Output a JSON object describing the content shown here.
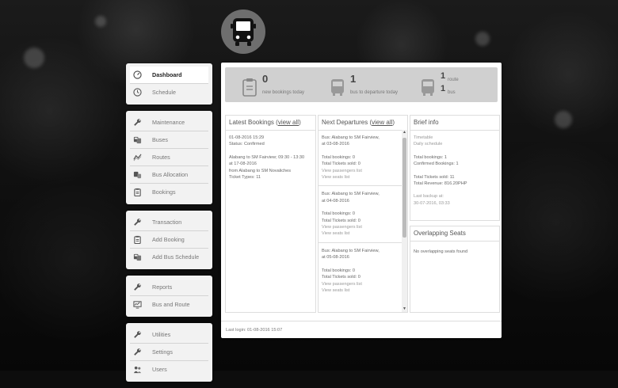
{
  "sidebar": {
    "groups": [
      {
        "items": [
          {
            "label": "Dashboard",
            "icon": "dashboard-icon",
            "active": true
          },
          {
            "label": "Schedule",
            "icon": "clock-icon"
          }
        ]
      },
      {
        "items": [
          {
            "label": "Maintenance",
            "icon": "wrench-icon"
          },
          {
            "label": "Buses",
            "icon": "buses-icon"
          },
          {
            "label": "Routes",
            "icon": "route-icon"
          },
          {
            "label": "Bus Allocation",
            "icon": "bus-allocation-icon"
          },
          {
            "label": "Bookings",
            "icon": "clipboard-icon"
          }
        ]
      },
      {
        "items": [
          {
            "label": "Transaction",
            "icon": "wrench-icon"
          },
          {
            "label": "Add Booking",
            "icon": "clipboard-icon"
          },
          {
            "label": "Add Bus Schedule",
            "icon": "buses-icon"
          }
        ]
      },
      {
        "items": [
          {
            "label": "Reports",
            "icon": "wrench-icon"
          },
          {
            "label": "Bus and Route",
            "icon": "chart-icon"
          }
        ]
      },
      {
        "items": [
          {
            "label": "Utilities",
            "icon": "wrench-icon"
          },
          {
            "label": "Settings",
            "icon": "wrench-icon"
          },
          {
            "label": "Users",
            "icon": "users-icon"
          }
        ]
      }
    ]
  },
  "stats": {
    "bookings": {
      "number": "0",
      "label": "new bookings today"
    },
    "departure": {
      "number": "1",
      "label": "bus to departure today"
    },
    "route": {
      "number": "1",
      "label": "route"
    },
    "bus": {
      "number": "1",
      "label": "bus"
    }
  },
  "latest_bookings": {
    "title": "Latest Bookings",
    "view_all": "view all",
    "lines": [
      "01-08-2016 15:29",
      "Status: Confirmed",
      "",
      "Alabang to SM Fairview; 09:30 - 13:30",
      "at 17-08-2016",
      "from Alabang to SM Novaliches",
      "Ticket Types: 11"
    ]
  },
  "next_departures": {
    "title": "Next Departures",
    "view_all": "view all",
    "entries": [
      {
        "bus": "Bus: Alabang to SM Fairview,",
        "date": "at 03-08-2016",
        "bookings": "Total bookings: 0",
        "tickets": "Total Tickets sold: 0",
        "passengers": "View passengers list",
        "seats": "View seats list"
      },
      {
        "bus": "Bus: Alabang to SM Fairview,",
        "date": "at 04-08-2016",
        "bookings": "Total bookings: 0",
        "tickets": "Total Tickets sold: 0",
        "passengers": "View passengers list",
        "seats": "View seats list"
      },
      {
        "bus": "Bus: Alabang to SM Fairview,",
        "date": "at 05-08-2016",
        "bookings": "Total bookings: 0",
        "tickets": "Total Tickets sold: 0",
        "passengers": "View passengers list",
        "seats": "View seats list"
      }
    ]
  },
  "brief_info": {
    "title": "Brief info",
    "timetable": "Timetable",
    "daily_schedule": "Daily schedule",
    "total_bookings": "Total bookings: 1",
    "confirmed_bookings": "Confirmed Bookings: 1",
    "tickets_sold": "Total Tickets sold: 11",
    "revenue": "Total Revenue: 816.20PHP",
    "last_backup": "Last backup at:",
    "backup_date": "30-07-2016, 03:33"
  },
  "overlapping": {
    "title": "Overlapping Seats",
    "text": "No overlapping seats found"
  },
  "footer": {
    "last_login": "Last login: 01-08-2016 15:07"
  },
  "colors": {
    "panel": "#ffffff",
    "stats_bar": "#d0d0d0",
    "logo": "#6e6e6e",
    "sidebar": "#f2f2f2"
  }
}
